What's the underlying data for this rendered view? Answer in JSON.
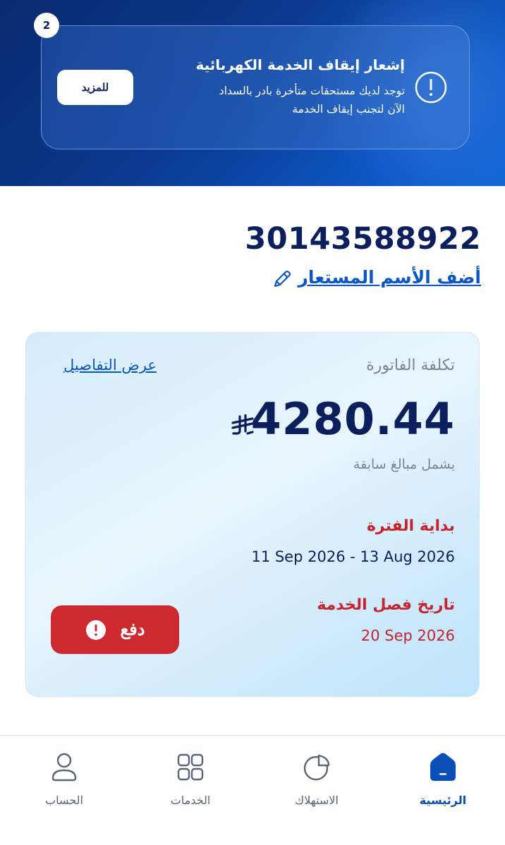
{
  "notice": {
    "badge_count": "2",
    "title": "إشعار إيقاف الخدمة الكهربائية",
    "body": "توجد لديك مستحقات متأخرة بادر بالسداد الآن لتجنب إيقاف الخدمة",
    "more_label": "للمزيد",
    "icon": "alert-circle-icon"
  },
  "account": {
    "number": "30143588922",
    "nickname_link": "أضف الأسم المستعار",
    "edit_icon": "pencil-icon"
  },
  "bill": {
    "label": "تكلفة الفاتورة",
    "details_link": "عرض التفاصيل",
    "amount": "4280.44",
    "currency_icon": "saudi-riyal-icon",
    "includes_note": "يشمل مبالغ سابقة",
    "period_label": "بداية الفترة",
    "period_value": "11 Sep 2026 - 13 Aug 2026",
    "disconnection_label": "تاريخ فصل الخدمة",
    "disconnection_date": "20 Sep 2026",
    "pay_label": "دفع",
    "pay_icon": "alert-circle-icon"
  },
  "nav": {
    "items": [
      {
        "label": "الرئيسية",
        "icon": "home-icon",
        "active": true
      },
      {
        "label": "الاستهلاك",
        "icon": "pie-chart-icon",
        "active": false
      },
      {
        "label": "الخدمات",
        "icon": "grid-icon",
        "active": false
      },
      {
        "label": "الحساب",
        "icon": "user-icon",
        "active": false
      }
    ]
  },
  "colors": {
    "primary_dark": "#0a1f5c",
    "link_blue": "#0a56c4",
    "alert_red": "#c8232c",
    "pay_red": "#cc2a2f",
    "active_nav": "#0a4fb8"
  }
}
